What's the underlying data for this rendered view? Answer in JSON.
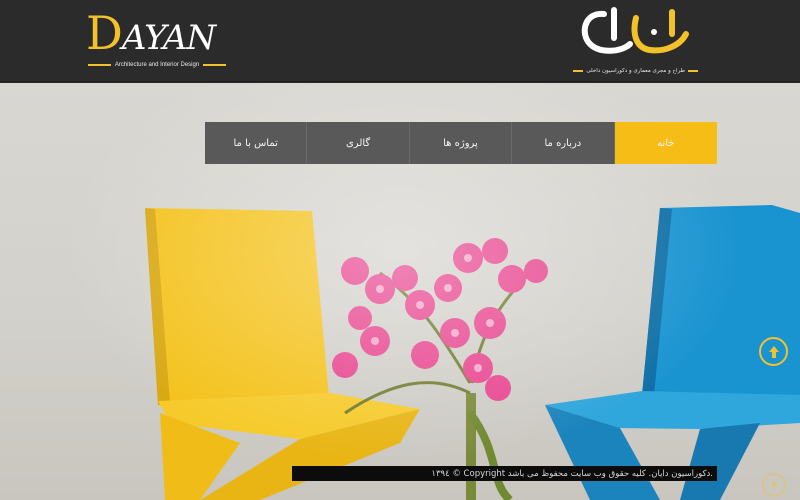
{
  "header": {
    "logo_en": {
      "first_letter": "D",
      "rest": "AYAN",
      "tagline": "Architecture and Interior Design"
    },
    "logo_fa": {
      "tagline": "طراح و مجری معماری و دکوراسیون داخلی"
    }
  },
  "nav": {
    "items": [
      {
        "label": "تماس با ما"
      },
      {
        "label": "گالری"
      },
      {
        "label": "پروژه ها"
      },
      {
        "label": "درباره ما"
      },
      {
        "label": "خانه"
      }
    ]
  },
  "footer": {
    "text": "۱۳۹٤ © Copyright دکوراسیون دایان. کلیه حقوق وب سایت محفوظ می باشد."
  },
  "colors": {
    "accent": "#f6bd16",
    "nav_bg": "#595959",
    "header_bg": "#2b2b2b"
  },
  "icons": {
    "to_top": "arrow-up-icon"
  }
}
